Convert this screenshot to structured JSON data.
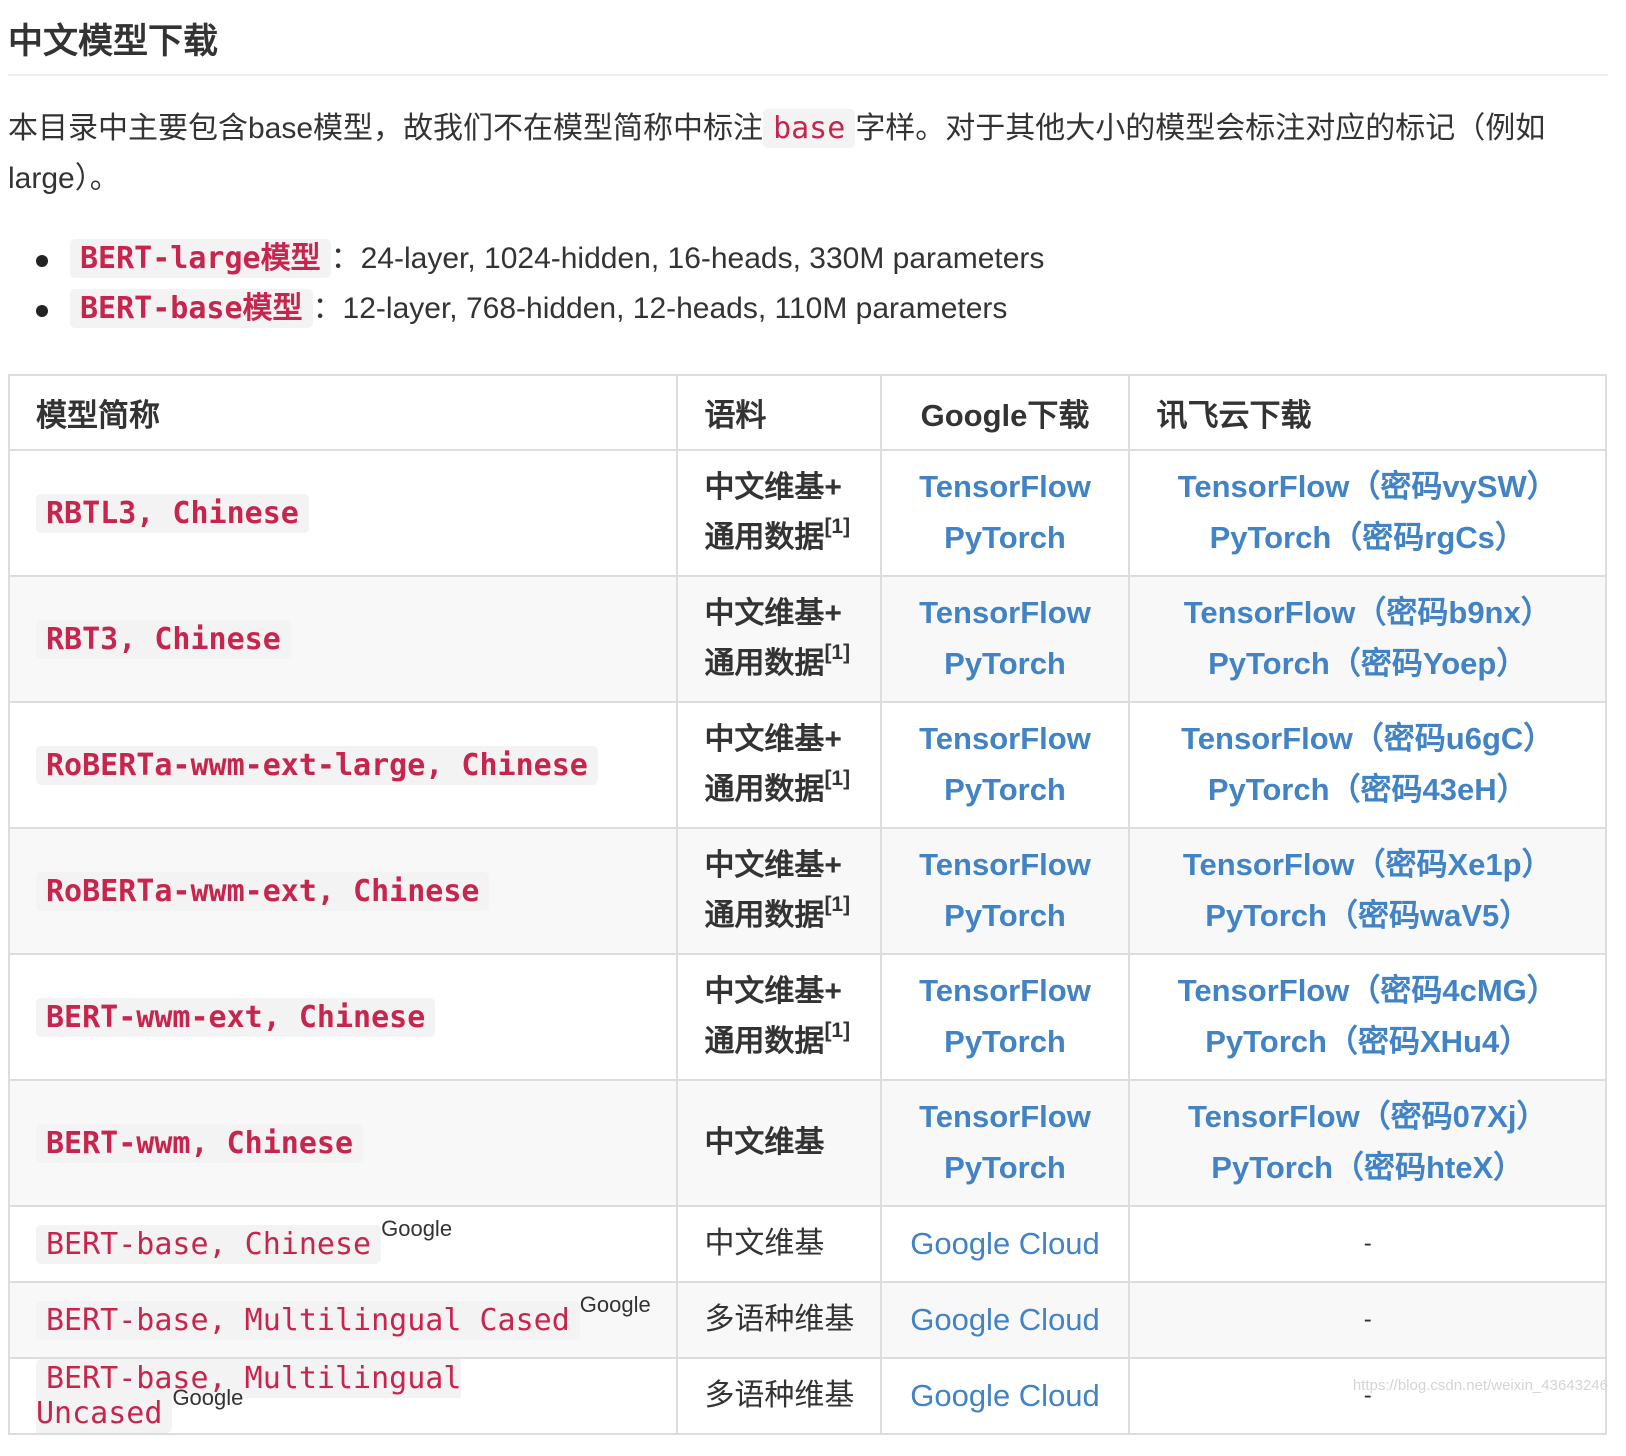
{
  "heading": "中文模型下载",
  "intro": {
    "before": "本目录中主要包含base模型，故我们不在模型简称中标注",
    "code": "base",
    "after": "字样。对于其他大小的模型会标注对应的标记（例如large）。"
  },
  "model_sizes": [
    {
      "name": "BERT-large模型",
      "desc": "：24-layer, 1024-hidden, 16-heads, 330M parameters"
    },
    {
      "name": "BERT-base模型",
      "desc": "：12-layer, 768-hidden, 12-heads, 110M parameters"
    }
  ],
  "table": {
    "headers": [
      "模型简称",
      "语料",
      "Google下载",
      "讯飞云下载"
    ],
    "rows": [
      {
        "name": "RBTL3, Chinese",
        "corpus_line1": "中文维基+",
        "corpus_line2": "通用数据",
        "corpus_sup": "[1]",
        "google": [
          "TensorFlow",
          "PyTorch"
        ],
        "xunfei": [
          "TensorFlow（密码vySW）",
          "PyTorch（密码rgCs）"
        ]
      },
      {
        "name": "RBT3, Chinese",
        "corpus_line1": "中文维基+",
        "corpus_line2": "通用数据",
        "corpus_sup": "[1]",
        "google": [
          "TensorFlow",
          "PyTorch"
        ],
        "xunfei": [
          "TensorFlow（密码b9nx）",
          "PyTorch（密码Yoep）"
        ]
      },
      {
        "name": "RoBERTa-wwm-ext-large, Chinese",
        "corpus_line1": "中文维基+",
        "corpus_line2": "通用数据",
        "corpus_sup": "[1]",
        "google": [
          "TensorFlow",
          "PyTorch"
        ],
        "xunfei": [
          "TensorFlow（密码u6gC）",
          "PyTorch（密码43eH）"
        ]
      },
      {
        "name": "RoBERTa-wwm-ext, Chinese",
        "corpus_line1": "中文维基+",
        "corpus_line2": "通用数据",
        "corpus_sup": "[1]",
        "google": [
          "TensorFlow",
          "PyTorch"
        ],
        "xunfei": [
          "TensorFlow（密码Xe1p）",
          "PyTorch（密码waV5）"
        ]
      },
      {
        "name": "BERT-wwm-ext, Chinese",
        "corpus_line1": "中文维基+",
        "corpus_line2": "通用数据",
        "corpus_sup": "[1]",
        "google": [
          "TensorFlow",
          "PyTorch"
        ],
        "xunfei": [
          "TensorFlow（密码4cMG）",
          "PyTorch（密码XHu4）"
        ]
      },
      {
        "name": "BERT-wwm, Chinese",
        "corpus": "中文维基",
        "google": [
          "TensorFlow",
          "PyTorch"
        ],
        "xunfei": [
          "TensorFlow（密码07Xj）",
          "PyTorch（密码hteX）"
        ]
      },
      {
        "name": "BERT-base, Chinese",
        "name_sup": "Google",
        "corpus": "中文维基",
        "google": [
          "Google Cloud"
        ],
        "xunfei": [
          "-"
        ]
      },
      {
        "name": "BERT-base, Multilingual Cased",
        "name_sup": "Google",
        "corpus": "多语种维基",
        "google": [
          "Google Cloud"
        ],
        "xunfei": [
          "-"
        ]
      },
      {
        "name": "BERT-base, Multilingual Uncased",
        "name_sup": "Google",
        "corpus": "多语种维基",
        "google": [
          "Google Cloud"
        ],
        "xunfei": [
          "-"
        ]
      }
    ]
  },
  "watermark": "https://blog.csdn.net/weixin_43643246"
}
